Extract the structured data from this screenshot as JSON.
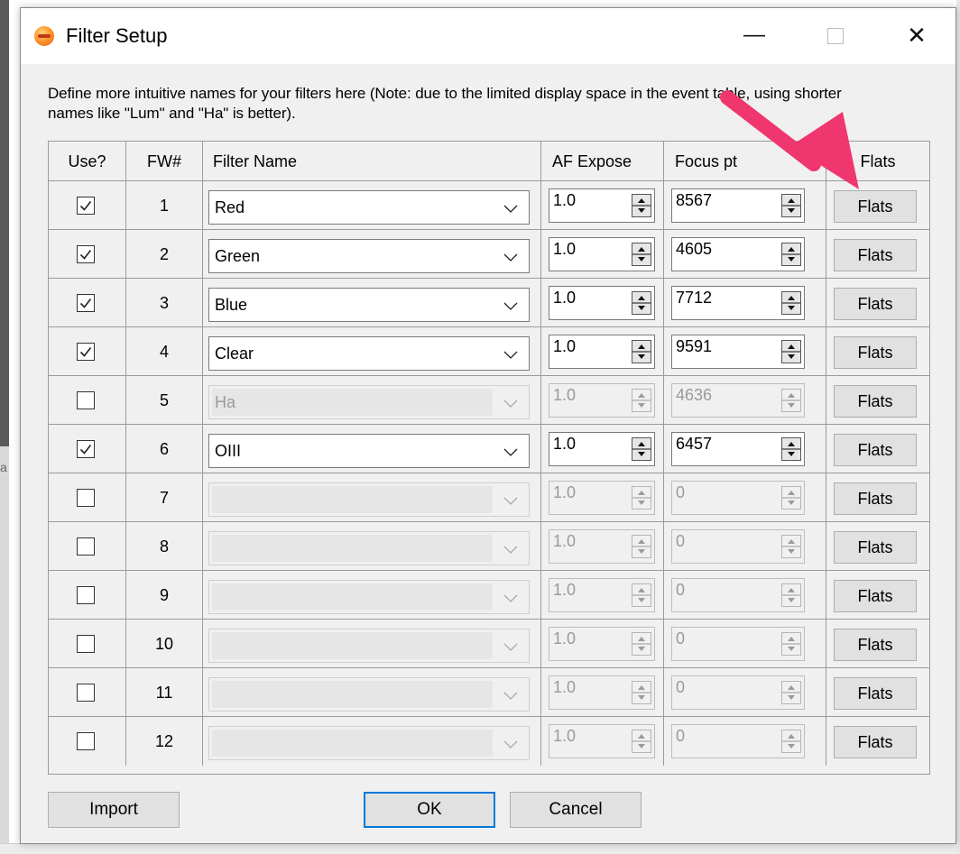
{
  "window": {
    "title": "Filter Setup",
    "minimize_glyph": "—",
    "close_glyph": "✕"
  },
  "background": {
    "cut_text": "a"
  },
  "description": "Define more intuitive names for your filters here (Note: due to the limited display space in the event table, using shorter names like \"Lum\" and \"Ha\" is better).",
  "table": {
    "headers": {
      "use": "Use?",
      "fw": "FW#",
      "name": "Filter Name",
      "af_expose": "AF Expose",
      "focus_pt": "Focus pt",
      "flats": "Flats"
    },
    "rows": [
      {
        "use": true,
        "fw": "1",
        "name": "Red",
        "af_expose": "1.0",
        "focus_pt": "8567",
        "enabled": true,
        "flats_label": "Flats"
      },
      {
        "use": true,
        "fw": "2",
        "name": "Green",
        "af_expose": "1.0",
        "focus_pt": "4605",
        "enabled": true,
        "flats_label": "Flats"
      },
      {
        "use": true,
        "fw": "3",
        "name": "Blue",
        "af_expose": "1.0",
        "focus_pt": "7712",
        "enabled": true,
        "flats_label": "Flats"
      },
      {
        "use": true,
        "fw": "4",
        "name": "Clear",
        "af_expose": "1.0",
        "focus_pt": "9591",
        "enabled": true,
        "flats_label": "Flats"
      },
      {
        "use": false,
        "fw": "5",
        "name": "Ha",
        "af_expose": "1.0",
        "focus_pt": "4636",
        "enabled": false,
        "flats_label": "Flats"
      },
      {
        "use": true,
        "fw": "6",
        "name": "OIII",
        "af_expose": "1.0",
        "focus_pt": "6457",
        "enabled": true,
        "flats_label": "Flats"
      },
      {
        "use": false,
        "fw": "7",
        "name": "",
        "af_expose": "1.0",
        "focus_pt": "0",
        "enabled": false,
        "flats_label": "Flats"
      },
      {
        "use": false,
        "fw": "8",
        "name": "",
        "af_expose": "1.0",
        "focus_pt": "0",
        "enabled": false,
        "flats_label": "Flats"
      },
      {
        "use": false,
        "fw": "9",
        "name": "",
        "af_expose": "1.0",
        "focus_pt": "0",
        "enabled": false,
        "flats_label": "Flats"
      },
      {
        "use": false,
        "fw": "10",
        "name": "",
        "af_expose": "1.0",
        "focus_pt": "0",
        "enabled": false,
        "flats_label": "Flats"
      },
      {
        "use": false,
        "fw": "11",
        "name": "",
        "af_expose": "1.0",
        "focus_pt": "0",
        "enabled": false,
        "flats_label": "Flats"
      },
      {
        "use": false,
        "fw": "12",
        "name": "",
        "af_expose": "1.0",
        "focus_pt": "0",
        "enabled": false,
        "flats_label": "Flats"
      }
    ]
  },
  "buttons": {
    "import": "Import",
    "ok": "OK",
    "cancel": "Cancel"
  },
  "icons": {
    "app": "app-logo-icon",
    "checkbox_check": "checkmark-icon",
    "dropdown": "chevron-down-icon",
    "spinner": "spin-updown-icon",
    "annotation": "annotation-arrow-icon"
  },
  "colors": {
    "dialog_bg": "#f0f0f0",
    "ok_border": "#0078d7",
    "annotation_arrow": "#f0366f"
  }
}
